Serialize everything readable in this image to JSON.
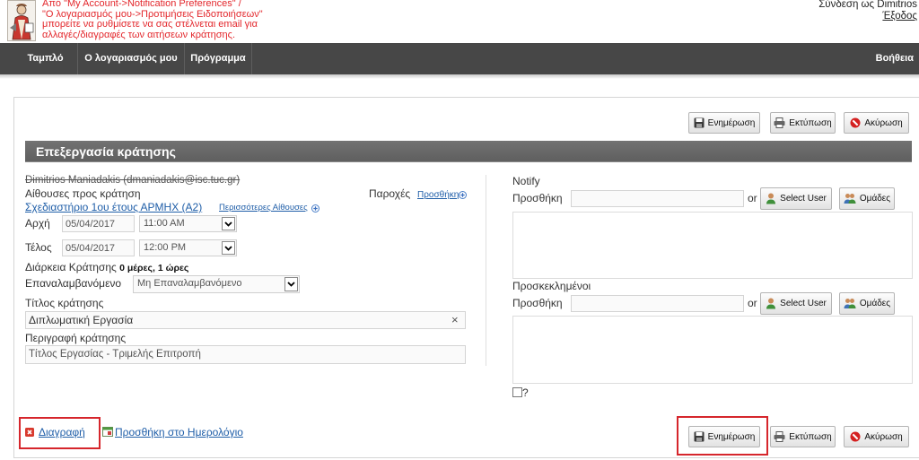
{
  "header": {
    "notice_lines": [
      "Από \"My Account->Notification Preferences\" /",
      "\"Ο λογαριασμός μου->Προτιμήσεις Ειδοποιήσεων\"",
      "μπορείτε να ρυθμίσετε να σας στέλνεται email για",
      "αλλαγές/διαγραφές των αιτήσεων κράτησης."
    ],
    "signed_in_as": "Σύνδεση ως Dimitrios",
    "logout": "Έξοδος"
  },
  "nav": {
    "items": [
      "Ταμπλό",
      "Ο λογαριασμός μου",
      "Πρόγραμμα"
    ],
    "help": "Βοήθεια"
  },
  "toolbar": {
    "update": {
      "label": "Ενημέρωση",
      "icon": "save-icon"
    },
    "print": {
      "label": "Εκτύπωση",
      "icon": "printer-icon"
    },
    "cancel": {
      "label": "Ακύρωση",
      "icon": "cancel-icon"
    }
  },
  "section_title": "Επεξεργασία κράτησης",
  "reservation": {
    "owner": "Dimitrios Maniadakis (dmaniadakis@isc.tuc.gr)",
    "rooms_label": "Αίθουσες προς κράτηση",
    "room": "Σχεδιαστήριο 1ου έτους ΑΡΜΗΧ (A2)",
    "more_rooms": "Περισσότερες Αίθουσες",
    "accessories_label": "Παροχές",
    "accessories_add": "Προσθήκη",
    "begin_label": "Αρχή",
    "begin_date": "05/04/2017",
    "begin_time": "11:00 AM",
    "end_label": "Τέλος",
    "end_date": "05/04/2017",
    "end_time": "12:00 PM",
    "duration_label": "Διάρκεια Κράτησης",
    "duration_value": "0 μέρες, 1 ώρες",
    "repeat_label": "Επαναλαμβανόμενο",
    "repeat_value": "Μη Επαναλαμβανόμενο",
    "title_label": "Τίτλος κράτησης",
    "title_value": "Διπλωματική Εργασία",
    "title_clear": "×",
    "description_label": "Περιγραφή κράτησης",
    "description_value": "Τίτλος Εργασίας - Τριμελής Επιτροπή"
  },
  "participants": {
    "notify": {
      "label": "Notify",
      "add_label": "Προσθήκη",
      "or": "or",
      "select_user": "Select User",
      "groups": "Ομάδες"
    },
    "invitees": {
      "label": "Προσκεκλημένοι",
      "add_label": "Προσθήκη",
      "or": "or",
      "select_user": "Select User",
      "groups": "Ομάδες"
    },
    "checkbox_label": "?",
    "checkbox_checked": false
  },
  "footer": {
    "delete": {
      "label": "Διαγραφή",
      "icon": "delete-icon"
    },
    "add_to_calendar": {
      "label": "Προσθήκη στο Ημερολόγιο",
      "icon": "calendar-icon"
    }
  },
  "colors": {
    "nav_bg": "#474747",
    "notice_red": "#e3262b",
    "link_blue": "#1f5ea8",
    "section_bg": "#5f5f5f",
    "highlight_red": "#d6262c"
  }
}
